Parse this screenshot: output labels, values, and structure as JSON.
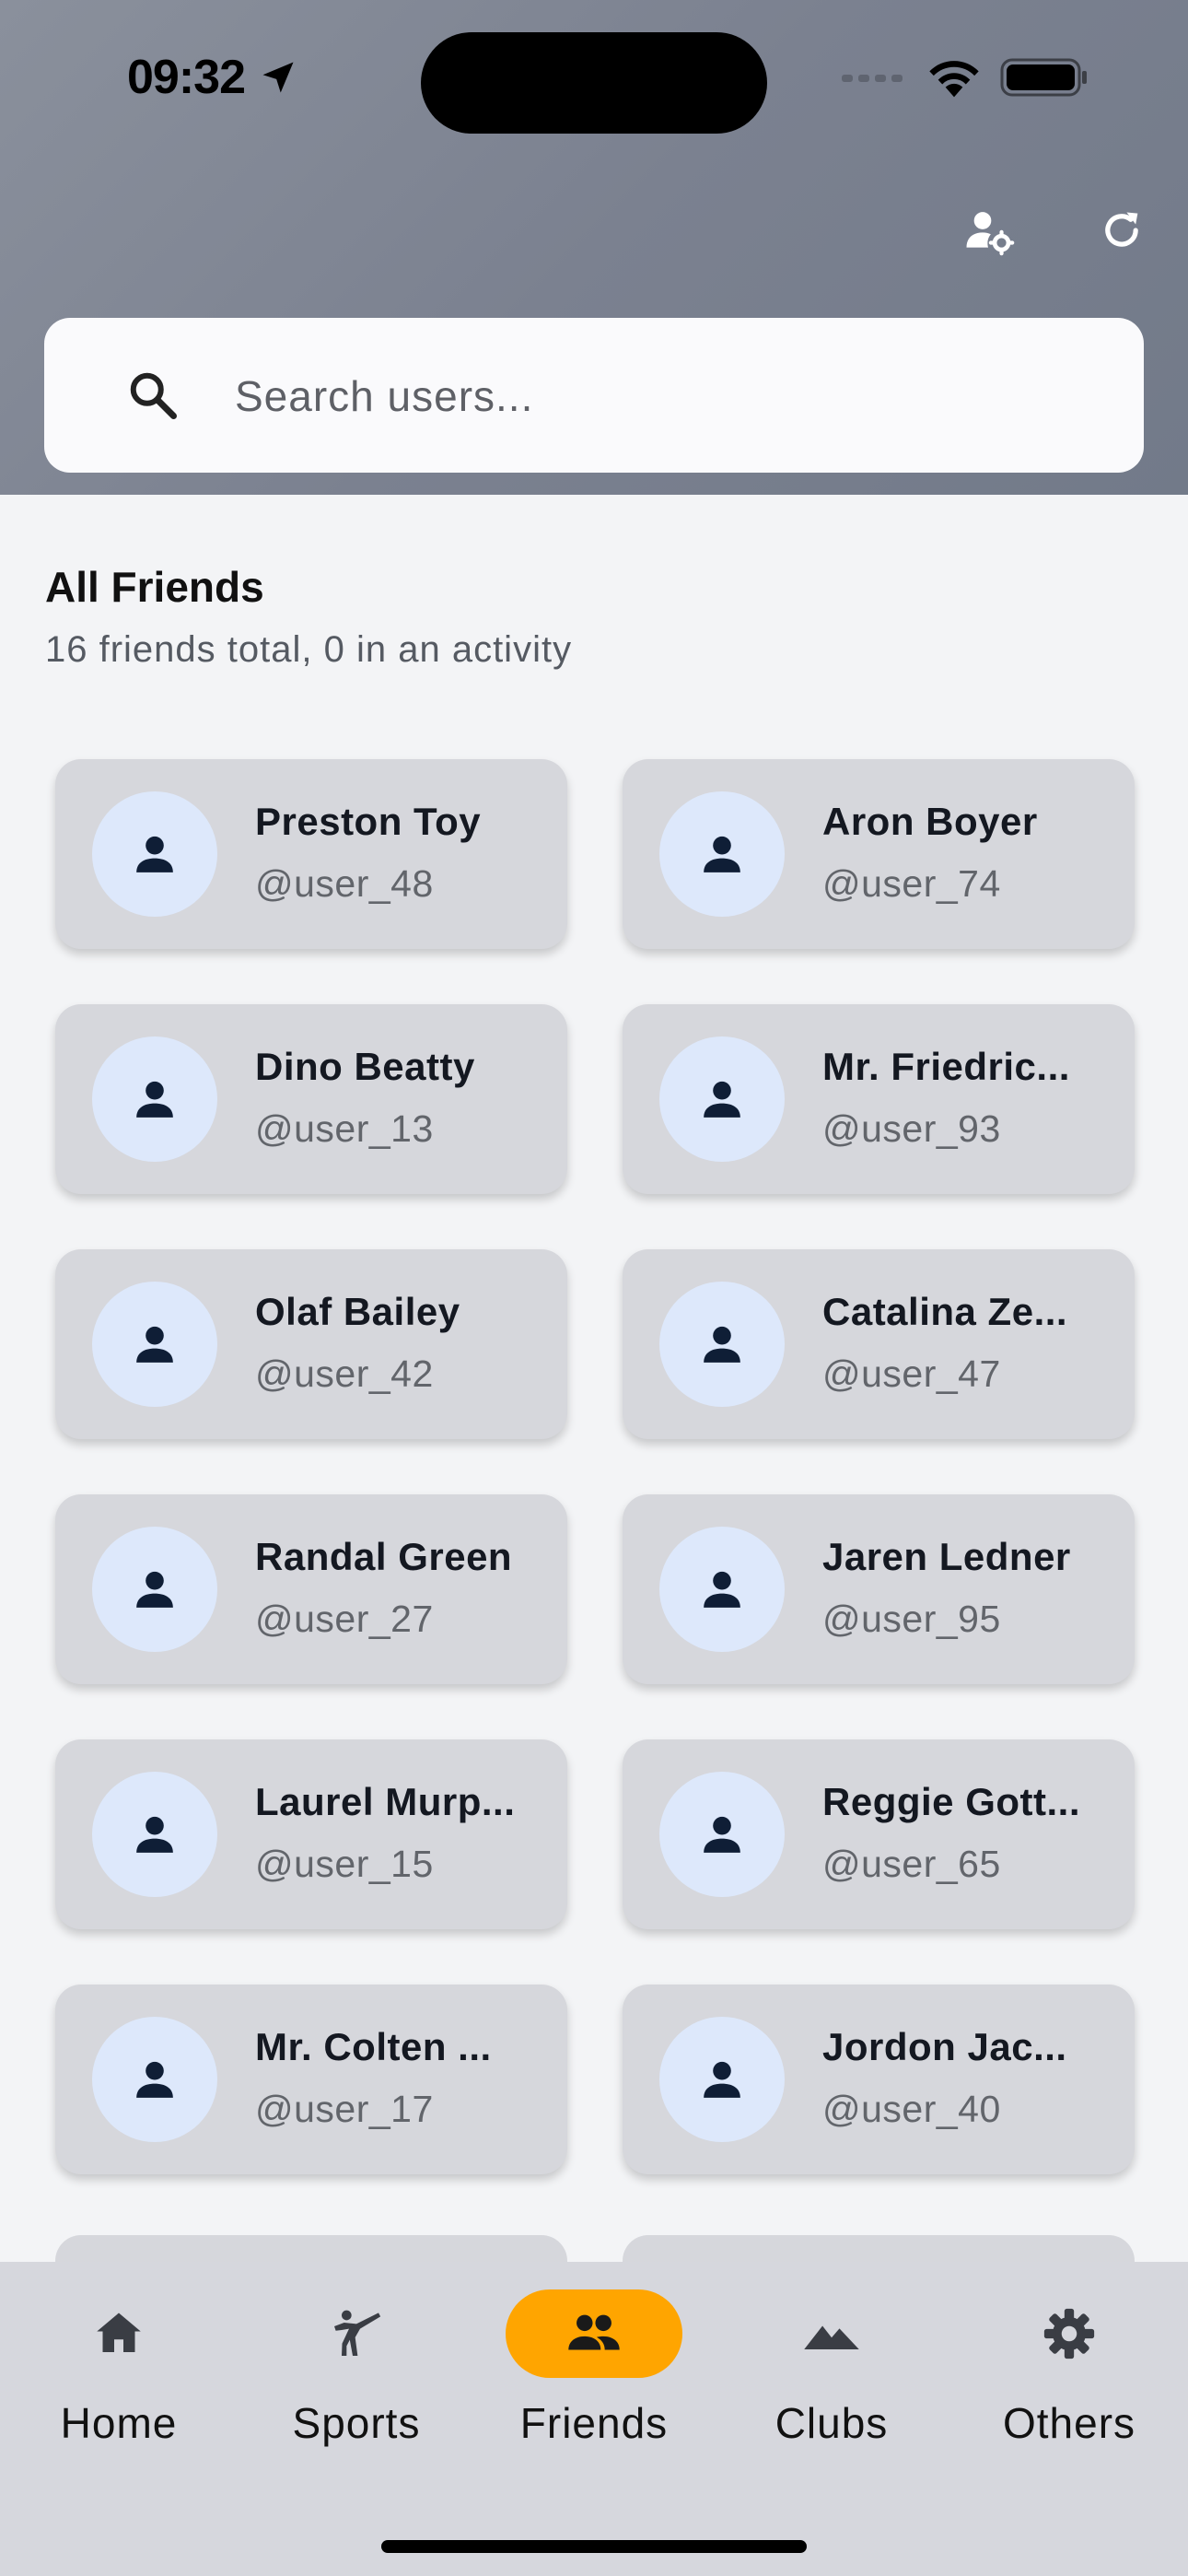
{
  "status_bar": {
    "time": "09:32"
  },
  "search": {
    "placeholder": "Search users..."
  },
  "section": {
    "title": "All Friends",
    "subtitle": "16 friends total, 0 in an activity"
  },
  "friends": [
    {
      "name": "Preston Toy",
      "handle": "@user_48"
    },
    {
      "name": "Aron Boyer",
      "handle": "@user_74"
    },
    {
      "name": "Dino Beatty",
      "handle": "@user_13"
    },
    {
      "name": "Mr. Friedric...",
      "handle": "@user_93"
    },
    {
      "name": "Olaf Bailey",
      "handle": "@user_42"
    },
    {
      "name": "Catalina Ze...",
      "handle": "@user_47"
    },
    {
      "name": "Randal Green",
      "handle": "@user_27"
    },
    {
      "name": "Jaren Ledner",
      "handle": "@user_95"
    },
    {
      "name": "Laurel Murp...",
      "handle": "@user_15"
    },
    {
      "name": "Reggie Gott...",
      "handle": "@user_65"
    },
    {
      "name": "Mr. Colten ...",
      "handle": "@user_17"
    },
    {
      "name": "Jordon Jac...",
      "handle": "@user_40"
    }
  ],
  "nav": {
    "items": [
      {
        "label": "Home",
        "icon": "home-icon"
      },
      {
        "label": "Sports",
        "icon": "sports-icon"
      },
      {
        "label": "Friends",
        "icon": "friends-icon"
      },
      {
        "label": "Clubs",
        "icon": "clubs-icon"
      },
      {
        "label": "Others",
        "icon": "settings-icon"
      }
    ],
    "active": "Friends"
  },
  "colors": {
    "accent": "#ffa500",
    "avatar_bg": "#dde8fb",
    "card_bg": "#d6d7dc"
  }
}
